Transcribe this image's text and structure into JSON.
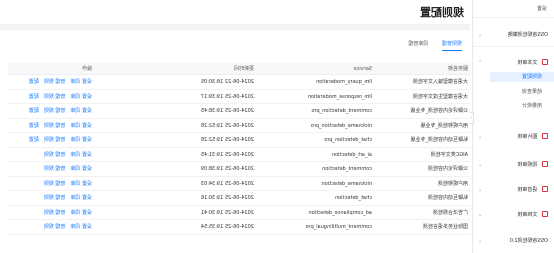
{
  "sidebar": {
    "top_label": "设置",
    "groups": [
      {
        "label": "OSS违规检测策略",
        "sub": []
      },
      {
        "label": "文本审核",
        "sub": [
          "规则配置",
          "结果查询",
          "用量统计"
        ]
      },
      {
        "label": "图片审核",
        "sub": []
      },
      {
        "label": "视频审核",
        "sub": []
      },
      {
        "label": "语音审核",
        "sub": []
      },
      {
        "label": "文档审核",
        "sub": []
      },
      {
        "label": "OSS违规检测2.0",
        "sub": []
      }
    ],
    "active_sub": "规则配置",
    "collapse_icon": "chevron-right-icon"
  },
  "page": {
    "title": "规则配置",
    "tabs": [
      "规则管理",
      "词库管理"
    ],
    "active_tab": "规则管理"
  },
  "table": {
    "headers": {
      "name": "服务名称",
      "service": "Service",
      "time": "更新时间",
      "ops": "操作"
    },
    "rows": [
      {
        "name": "大语言模型输入文字检测",
        "service": "llm_query_moderation",
        "time": "2024-06-22 18:30:05",
        "ops": [
          "设置 词库",
          "管理 规则",
          "配置"
        ]
      },
      {
        "name": "大语言模型生成文字检测",
        "service": "llm_response_moderation",
        "time": "2024-06-25 19:39:17",
        "ops": [
          "设置 词库",
          "管理 规则",
          "配置"
        ]
      },
      {
        "name": "公聊评论内容检测_专业版",
        "service": "comment_detection_pro",
        "time": "2024-06-25 19:38:45",
        "ops": [
          "设置 词库",
          "管理 规则",
          "配置"
        ]
      },
      {
        "name": "用户昵称检测_专业版",
        "service": "nickname_detection_pro",
        "time": "2024-06-25 19:52:28",
        "ops": [
          "设置 词库",
          "管理 规则",
          "配置"
        ]
      },
      {
        "name": "私聊互动内容检测_专业版",
        "service": "chat_detection_pro",
        "time": "2024-06-25 19:52:28",
        "ops": [
          "设置 词库",
          "管理 规则",
          "配置"
        ]
      },
      {
        "name": "AIGC类文字检测",
        "service": "ai_art_detection",
        "time": "2024-06-25 19:31:45",
        "ops": [
          "设置 词库",
          "管理 规则"
        ]
      },
      {
        "name": "公聊评论内容检测",
        "service": "comment_detection",
        "time": "2024-06-25 19:38:09",
        "ops": [
          "设置 词库",
          "管理 规则"
        ]
      },
      {
        "name": "用户昵称检测",
        "service": "nickname_detection",
        "time": "2024-06-25 19:34:03",
        "ops": [
          "设置 词库",
          "管理 规则"
        ]
      },
      {
        "name": "私聊互动内容检测",
        "service": "chat_detection",
        "time": "2024-06-25 19:30:16",
        "ops": [
          "设置 词库",
          "管理 规则"
        ]
      },
      {
        "name": "广告法合规检测",
        "service": "ad_compliance_detection",
        "time": "2024-06-25 19:30:41",
        "ops": [
          "设置 词库",
          "管理 规则"
        ]
      },
      {
        "name": "国际业务多语言检测",
        "service": "comment_multilingual_pro",
        "time": "2024-06-25 19:35:54",
        "ops": [
          "设置 词库",
          "管理 规则"
        ]
      }
    ]
  }
}
